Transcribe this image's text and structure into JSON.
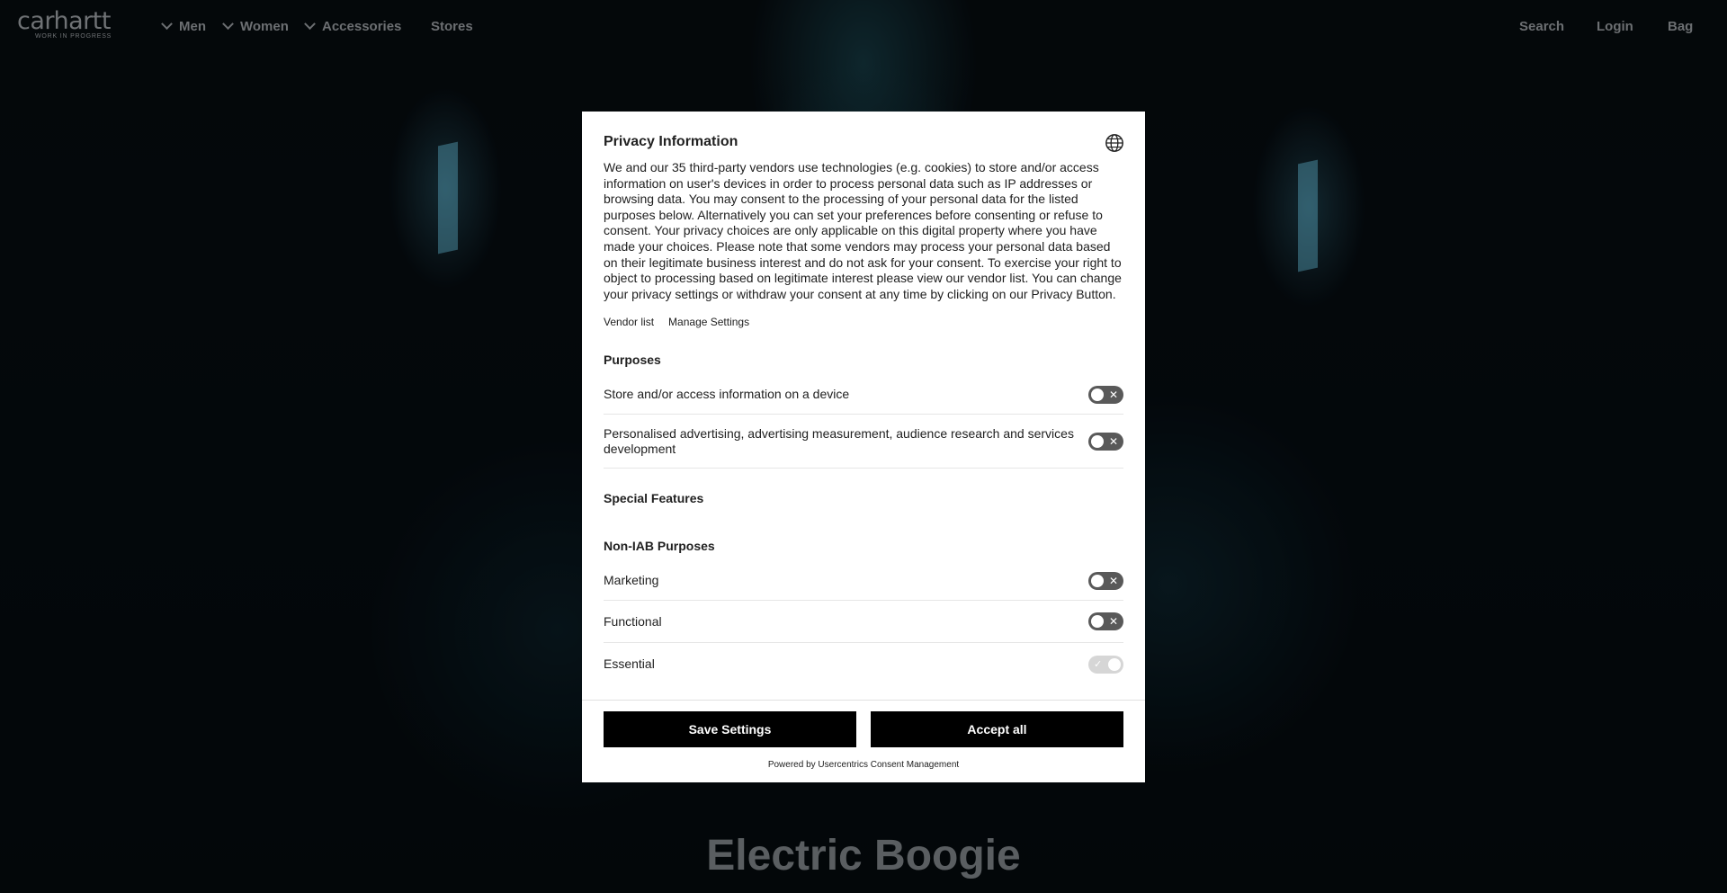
{
  "nav": {
    "logo": "carhartt",
    "logo_sub": "WORK IN PROGRESS",
    "items": [
      {
        "label": "Men"
      },
      {
        "label": "Women"
      },
      {
        "label": "Accessories"
      }
    ],
    "stores": "Stores",
    "search": "Search",
    "login": "Login",
    "bag": "Bag"
  },
  "hero": {
    "title": "Electric Boogie"
  },
  "consent": {
    "title": "Privacy Information",
    "description": "We and our 35 third-party vendors use technologies (e.g. cookies) to store and/or access information on user's devices in order to process personal data such as IP addresses or browsing data. You may consent to the processing of your personal data for the listed purposes below. Alternatively you can set your preferences before consenting or refuse to consent. Your privacy choices are only applicable on this digital property where you have made your choices. Please note that some vendors may process your personal data based on their legitimate business interest and do not ask for your consent. To exercise your right to object to processing based on legitimate interest please view our vendor list. You can change your privacy settings or withdraw your consent at any time by clicking on our Privacy Button.",
    "vendor_list": "Vendor list",
    "manage_settings": "Manage Settings",
    "purposes_heading": "Purposes",
    "purposes": [
      {
        "label": "Store and/or access information on a device",
        "enabled": false
      },
      {
        "label": "Personalised advertising, advertising measurement, audience research and services development",
        "enabled": false
      }
    ],
    "special_features_heading": "Special Features",
    "non_iab_heading": "Non-IAB Purposes",
    "non_iab": [
      {
        "label": "Marketing",
        "enabled": false
      },
      {
        "label": "Functional",
        "enabled": false
      },
      {
        "label": "Essential",
        "enabled": true
      }
    ],
    "save_button": "Save Settings",
    "accept_button": "Accept all",
    "powered_by": "Powered by Usercentrics Consent Management"
  },
  "colors": {
    "modal_bg": "#ffffff",
    "button_bg": "#000000",
    "toggle_off": "#595959",
    "toggle_on_disabled": "#d6d6d6",
    "nav_text": "#6c6f72"
  }
}
